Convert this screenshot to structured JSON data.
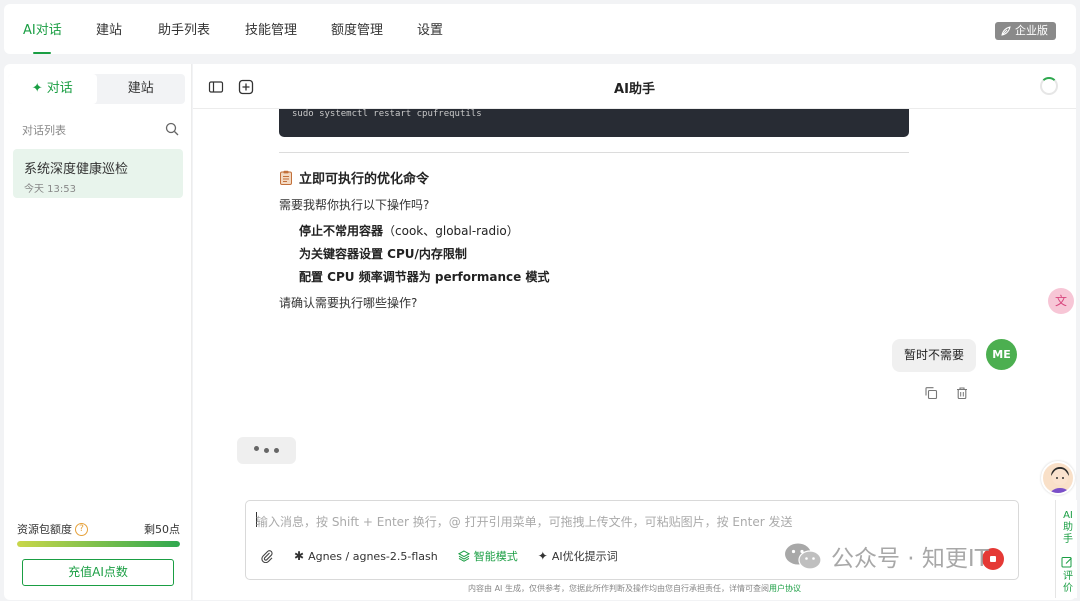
{
  "topnav": {
    "tabs": [
      "AI对话",
      "建站",
      "助手列表",
      "技能管理",
      "额度管理",
      "设置"
    ],
    "active_index": 0,
    "enterprise_badge": "企业版"
  },
  "sidebar": {
    "tabs": [
      "对话",
      "建站"
    ],
    "active_index": 0,
    "list_label": "对话列表",
    "conversations": [
      {
        "title": "系统深度健康巡检",
        "time": "今天 13:53"
      }
    ],
    "quota": {
      "label": "资源包额度",
      "remaining": "剩50点",
      "fill_fraction": 1.0
    },
    "recharge_label": "充值AI点数"
  },
  "main": {
    "title": "AI助手",
    "code_line": "sudo systemctl restart cpufrequtils",
    "section_title": "立即可执行的优化命令",
    "question": "需要我帮你执行以下操作吗?",
    "bullets": [
      {
        "bold": "停止不常用容器",
        "normal": "（cook、global-radio）"
      },
      {
        "bold": "为关键容器设置 CPU/内存限制",
        "normal": ""
      },
      {
        "bold": "配置 CPU 频率调节器为 performance 模式",
        "normal": ""
      }
    ],
    "confirm": "请确认需要执行哪些操作?",
    "user_message": "暂时不需要",
    "user_avatar": "ME",
    "input": {
      "placeholder": "输入消息，按 Shift + Enter 换行，@ 打开引用菜单，可拖拽上传文件，可粘贴图片，按 Enter 发送",
      "model": "Agnes / agnes-2.5-flash",
      "smart_mode": "智能模式",
      "optimize": "AI优化提示词"
    },
    "footer_note": "内容由 AI 生成，仅供参考，您据此所作判断及操作均由您自行承担责任，详情可查阅",
    "footer_link": "用户协议",
    "watermark": "公众号 · 知更IT"
  },
  "rail": {
    "translate_glyph": "文",
    "assistant_label": "AI助手",
    "review_label": "评价"
  },
  "colors": {
    "accent": "#1a9e43",
    "stop": "#e53935"
  }
}
